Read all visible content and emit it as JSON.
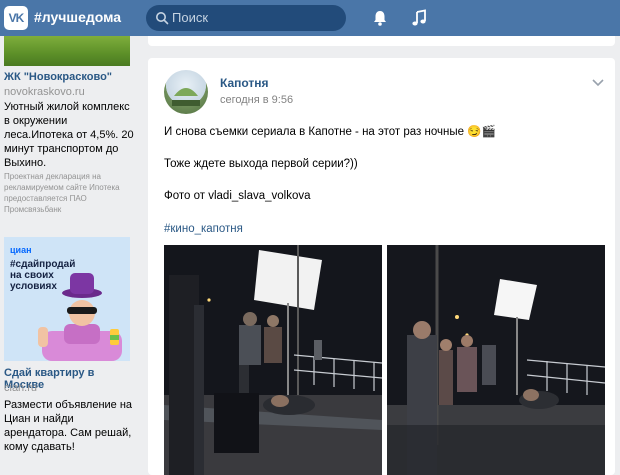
{
  "header": {
    "logo": "VK",
    "title": "#лучшедома",
    "search_placeholder": "Поиск",
    "icons": [
      "bell-icon",
      "music-icon"
    ]
  },
  "sidebar": {
    "ad1": {
      "title": "ЖК \"Новокрасково\"",
      "domain": "novokraskovo.ru",
      "text": "Уютный жилой комплекс в окружении леса.Ипотека от 4,5%. 20 минут транспортом до Выхино.",
      "note": "Проектная декларация на рекламируемом сайте Ипотека предоставляется ПАО Промсвязьбанк"
    },
    "ad2": {
      "banner_logo": "циан",
      "banner_text": "#сдайпродай на своих условиях",
      "title": "Сдай квартиру в Москве",
      "domain": "cian.ru",
      "text": "Размести объявление на Циан и найди арендатора. Сам решай, кому сдавать!"
    }
  },
  "post": {
    "author": "Капотня",
    "time": "сегодня в 9:56",
    "line1": "И снова съемки сериала в Капотне - на этот раз ночные 😏🎬",
    "line2": "Тоже ждете выхода первой серии?))",
    "line3_prefix": "Фото от ",
    "line3_link": "vladi_slava_volkova",
    "hashtag": "#кино_капотня"
  },
  "colors": {
    "header": "#4a76a8",
    "link": "#2a5885",
    "background": "#edeef0"
  }
}
